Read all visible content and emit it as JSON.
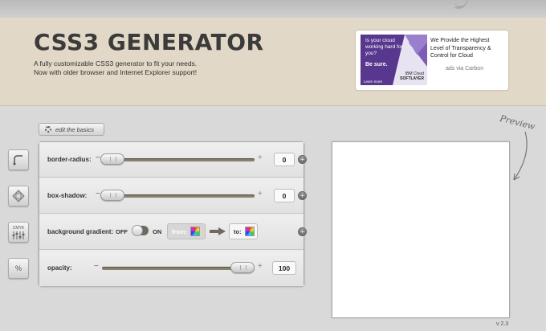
{
  "header": {
    "title": "CSS3 GENERATOR",
    "tagline_line1": "A fully customizable CSS3 generator to fit your needs.",
    "tagline_line2": "Now with older browser and Internet Explorer support!"
  },
  "ad": {
    "image_question": "Is your cloud working hard for you?",
    "image_sure": "Be sure.",
    "image_brand_1": "IBM Cloud",
    "image_brand_2": "SOFTLAYER",
    "image_learn": "Learn more",
    "text": "We Provide the Highest Level of Transparency & Control for Cloud",
    "via": "ads via Carbon"
  },
  "sidebar": {
    "buttons": [
      {
        "name": "border-radius",
        "icon": "rounded-corner-icon",
        "glyph": "⌜"
      },
      {
        "name": "box-shadow",
        "icon": "shadow-diamond-icon",
        "glyph": "◆"
      },
      {
        "name": "gradient",
        "icon": "cmyk-icon",
        "glyph": "CMYK"
      },
      {
        "name": "opacity",
        "icon": "percent-icon",
        "glyph": "%"
      }
    ]
  },
  "edit_basics": {
    "label": "edit the basics",
    "icon": "gear-icon"
  },
  "controls": {
    "border_radius": {
      "label": "border-radius:",
      "value": "0",
      "minus": "−",
      "plus": "+"
    },
    "box_shadow": {
      "label": "box-shadow:",
      "value": "0",
      "minus": "−",
      "plus": "+"
    },
    "gradient": {
      "label": "background gradient:",
      "off": "OFF",
      "on": "ON",
      "from": "from:",
      "to": "to:"
    },
    "opacity": {
      "label": "opacity:",
      "value": "100",
      "minus": "−",
      "plus": "+"
    }
  },
  "expand_symbol": "+",
  "preview": {
    "label": "Preview"
  },
  "version": "v 2.3",
  "colors": {
    "header_bg": "#e2d8c7",
    "page_bg": "#d9d9d9",
    "ad_purple": "#58378f",
    "slider_track": "#8b8170"
  }
}
